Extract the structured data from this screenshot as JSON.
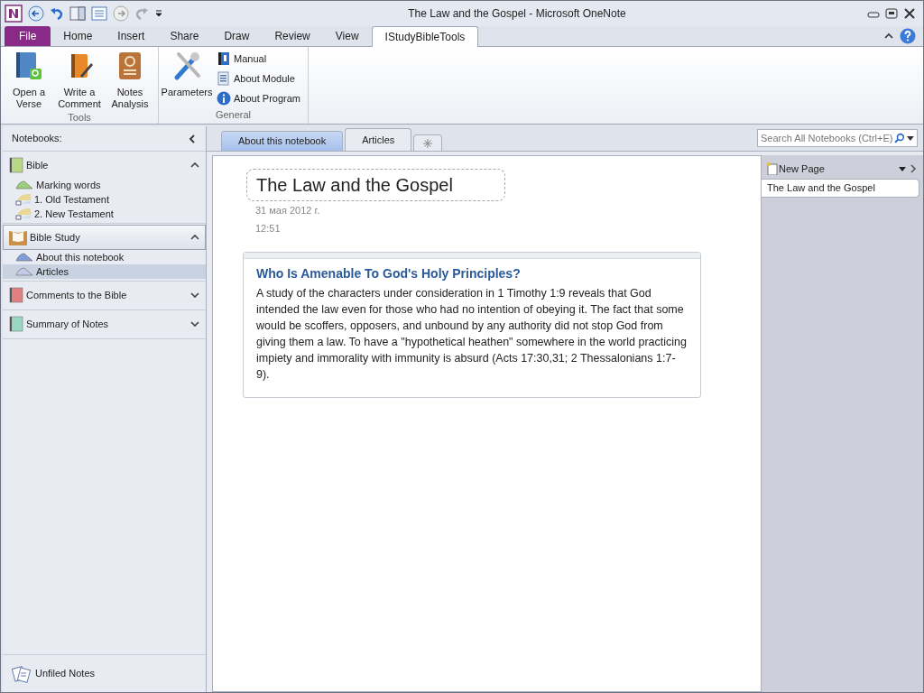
{
  "window": {
    "title": "The Law and the Gospel - Microsoft OneNote"
  },
  "ribbon": {
    "tabs": [
      {
        "label": "File",
        "kind": "file",
        "selected": false
      },
      {
        "label": "Home",
        "kind": "tab",
        "selected": false
      },
      {
        "label": "Insert",
        "kind": "tab",
        "selected": false
      },
      {
        "label": "Share",
        "kind": "tab",
        "selected": false
      },
      {
        "label": "Draw",
        "kind": "tab",
        "selected": false
      },
      {
        "label": "Review",
        "kind": "tab",
        "selected": false
      },
      {
        "label": "View",
        "kind": "tab",
        "selected": false
      },
      {
        "label": "IStudyBibleTools",
        "kind": "tab",
        "selected": true
      }
    ],
    "groups": [
      {
        "label": "Tools",
        "items": [
          {
            "label": "Open a Verse",
            "kind": "large"
          },
          {
            "label": "Write a Comment",
            "kind": "large"
          },
          {
            "label": "Notes Analysis",
            "kind": "large"
          }
        ]
      },
      {
        "label": "General",
        "items": [
          {
            "label": "Parameters",
            "kind": "large"
          },
          {
            "label": "Manual",
            "kind": "small"
          },
          {
            "label": "About Module",
            "kind": "small"
          },
          {
            "label": "About Program",
            "kind": "small"
          }
        ]
      }
    ]
  },
  "sidebar": {
    "header": "Notebooks:",
    "notebooks": [
      {
        "name": "Bible",
        "kind": "notebook",
        "color": "#b8d888",
        "expanded": true,
        "selected": false,
        "sections": [
          {
            "name": "Marking words",
            "kind": "section",
            "color": "#9ad07a",
            "selected": false
          },
          {
            "name": "1. Old Testament",
            "kind": "group",
            "color": "#e8d890",
            "selected": false
          },
          {
            "name": "2. New Testament",
            "kind": "group",
            "color": "#e8d890",
            "selected": false
          }
        ]
      },
      {
        "name": "Bible Study",
        "kind": "book",
        "color": "#c89048",
        "expanded": true,
        "selected": true,
        "sections": [
          {
            "name": "About this notebook",
            "kind": "section",
            "color": "#7f9ed8",
            "selected": false
          },
          {
            "name": "Articles",
            "kind": "section",
            "color": "#c8c8e8",
            "selected": true
          }
        ]
      },
      {
        "name": "Comments to the Bible",
        "kind": "notebook",
        "color": "#e08080",
        "expanded": false,
        "selected": false
      },
      {
        "name": "Summary of Notes",
        "kind": "notebook",
        "color": "#98d8c0",
        "expanded": false,
        "selected": false
      }
    ],
    "unfiled": "Unfiled Notes"
  },
  "section_tabs": [
    {
      "label": "About this notebook",
      "selected": false
    },
    {
      "label": "Articles",
      "selected": true
    }
  ],
  "search": {
    "placeholder": "Search All Notebooks (Ctrl+E)"
  },
  "page": {
    "title": "The Law and the Gospel",
    "date": "31 мая 2012 г.",
    "time": "12:51",
    "note": {
      "heading": "Who Is Amenable To God's Holy Principles?",
      "body": "A study of the characters under consideration in 1 Timothy 1:9 reveals that God intended the law even for those who had no intention of obeying it. The fact that some would be scoffers, opposers, and unbound by any authority did not stop God from giving them a law. To have a \"hypothetical heathen\" somewhere in the world practicing impiety and immorality with immunity is absurd (Acts 17:30,31; 2 Thessalonians 1:7-9)."
    }
  },
  "page_list": {
    "new_page": "New Page",
    "pages": [
      {
        "title": "The Law and the Gospel",
        "selected": true
      }
    ]
  }
}
